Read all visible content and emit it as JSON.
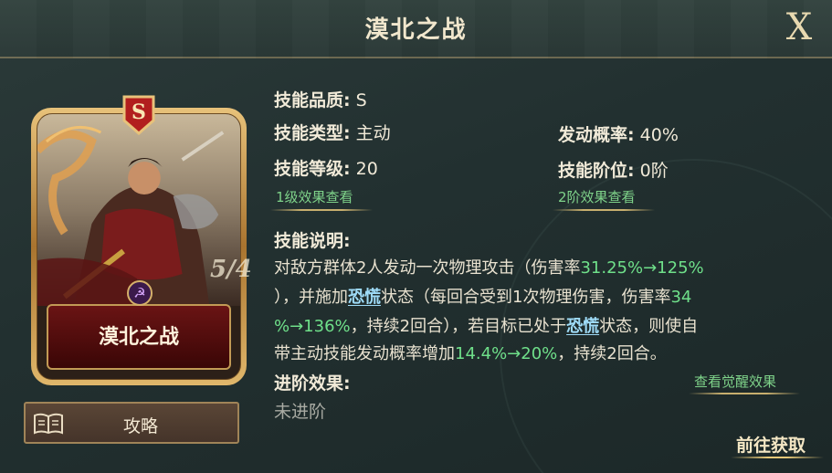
{
  "header": {
    "title": "漠北之战",
    "close_label": "X"
  },
  "card": {
    "name": "漠北之战",
    "grade_badge": "S",
    "level_mark": "5/4",
    "guide_button": "攻略",
    "colors": {
      "frame": "#d4a85a",
      "plate": "#5a0e0e"
    }
  },
  "skill": {
    "quality": {
      "label": "技能品质:",
      "value": "S"
    },
    "type": {
      "label": "技能类型:",
      "value": "主动"
    },
    "rate": {
      "label": "发动概率:",
      "value": "40%"
    },
    "level": {
      "label": "技能等级:",
      "value": "20"
    },
    "stage": {
      "label": "技能阶位:",
      "value": "0阶"
    },
    "link_lv1": "1级效果查看",
    "link_lv2": "2阶效果查看"
  },
  "description": {
    "title": "技能说明:",
    "line1": {
      "a": "对敌方群体2人发动一次物理攻击（伤害率",
      "b": "31.25%→125%"
    },
    "line2": {
      "a": "），并施加",
      "kw": "恐慌",
      "b": "状态（每回合受到1次物理伤害，伤害率",
      "c": "34"
    },
    "line3": {
      "a": "%→136%",
      "b": "，持续2回合），若目标已处于",
      "kw": "恐慌",
      "c": "状态，则使自"
    },
    "line4": {
      "a": "带主动技能发动概率增加",
      "b": "14.4%→20%",
      "c": "，持续2回合。"
    }
  },
  "advance": {
    "title": "进阶效果:",
    "value": "未进阶",
    "awaken_link": "查看觉醒效果"
  },
  "obtain_button": "前往获取"
}
